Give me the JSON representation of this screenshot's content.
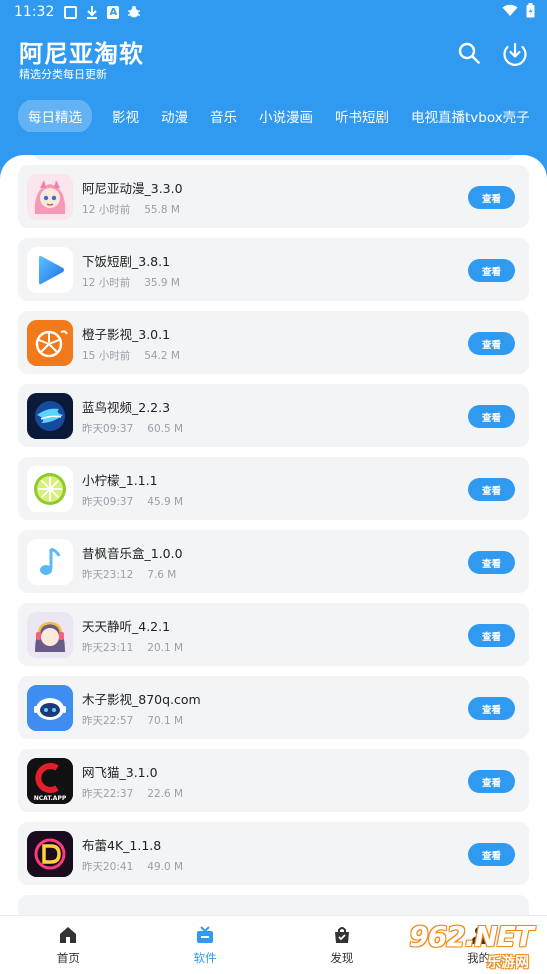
{
  "status_bar": {
    "time": "11:32",
    "icons": [
      "notification-box-icon",
      "download-icon",
      "a-box-icon",
      "bug-icon",
      "wifi-icon",
      "battery-icon"
    ]
  },
  "header": {
    "title": "阿尼亚淘软",
    "subtitle": "精选分类每日更新",
    "search_icon": "search-icon",
    "download_icon": "download-circle-icon"
  },
  "tabs": [
    {
      "label": "每日精选",
      "active": true
    },
    {
      "label": "影视"
    },
    {
      "label": "动漫"
    },
    {
      "label": "音乐"
    },
    {
      "label": "小说漫画"
    },
    {
      "label": "听书短剧"
    },
    {
      "label": "电视直播tvbox壳子"
    }
  ],
  "apps": [
    {
      "name": "阿尼亚动漫_3.3.0",
      "time": "12 小时前",
      "size": "55.8 M",
      "icon": "anime-girl-icon",
      "button": "查看"
    },
    {
      "name": "下饭短剧_3.8.1",
      "time": "12 小时前",
      "size": "35.9 M",
      "icon": "play-triangle-icon",
      "button": "查看"
    },
    {
      "name": "橙子影视_3.0.1",
      "time": "15 小时前",
      "size": "54.2 M",
      "icon": "orange-slice-icon",
      "button": "查看"
    },
    {
      "name": "蓝鸟视频_2.2.3",
      "time": "昨天09:37",
      "size": "60.5 M",
      "icon": "blue-bird-icon",
      "button": "查看"
    },
    {
      "name": "小柠檬_1.1.1",
      "time": "昨天09:37",
      "size": "45.9 M",
      "icon": "lemon-slice-icon",
      "button": "查看"
    },
    {
      "name": "昔枫音乐盒_1.0.0",
      "time": "昨天23:12",
      "size": "7.6 M",
      "icon": "music-note-icon",
      "button": "查看"
    },
    {
      "name": "天天静听_4.2.1",
      "time": "昨天23:11",
      "size": "20.1 M",
      "icon": "girl-listening-icon",
      "button": "查看"
    },
    {
      "name": "木子影视_870q.com",
      "time": "昨天22:57",
      "size": "70.1 M",
      "icon": "robot-face-icon",
      "button": "查看"
    },
    {
      "name": "网飞猫_3.1.0",
      "time": "昨天22:37",
      "size": "22.6 M",
      "icon": "ncat-logo-icon",
      "icon_text": "NCAT.APP",
      "button": "查看"
    },
    {
      "name": "布蕾4K_1.1.8",
      "time": "昨天20:41",
      "size": "49.0 M",
      "icon": "d-logo-icon",
      "button": "查看"
    }
  ],
  "bottom_nav": [
    {
      "label": "首页",
      "icon": "home-icon"
    },
    {
      "label": "软件",
      "icon": "software-icon",
      "active": true
    },
    {
      "label": "发现",
      "icon": "discover-bag-icon"
    },
    {
      "label": "我的",
      "icon": "user-icon"
    }
  ],
  "watermark": {
    "number": "962.NET",
    "text": "乐游网"
  },
  "colors": {
    "primary": "#2f9af0",
    "card_bg": "#f3f4f6",
    "meta_text": "#9aa0a6"
  }
}
